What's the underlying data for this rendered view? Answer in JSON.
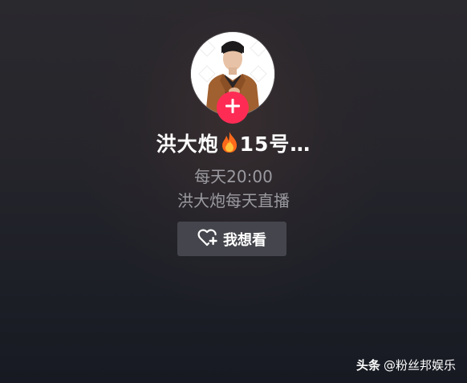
{
  "stream_card": {
    "streamer_name_part1": "洪大炮",
    "streamer_name_part2": "15号…",
    "schedule_time": "每天20:00",
    "schedule_desc": "洪大炮每天直播",
    "want_button_label": "我想看",
    "follow_icon": "plus-icon",
    "name_icon": "fire-icon"
  },
  "watermark": {
    "brand": "头条",
    "handle": "@粉丝邦娱乐"
  },
  "colors": {
    "follow_accent": "#fe2c55",
    "button_bg": "#45464d",
    "secondary_text": "#9a9aa0"
  }
}
